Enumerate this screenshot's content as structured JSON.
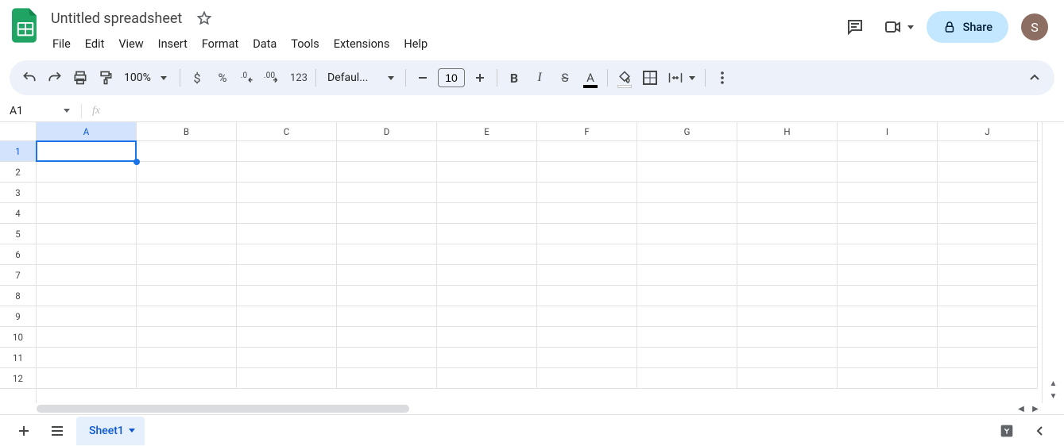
{
  "header": {
    "doc_title": "Untitled spreadsheet",
    "menus": [
      "File",
      "Edit",
      "View",
      "Insert",
      "Format",
      "Data",
      "Tools",
      "Extensions",
      "Help"
    ],
    "share_label": "Share",
    "avatar_initial": "S"
  },
  "toolbar": {
    "zoom": "100%",
    "currency_label": "$",
    "percent_label": "%",
    "num123_label": "123",
    "font_family": "Defaul...",
    "font_size": "10",
    "text_color": "#000000",
    "fill_color": "#ffffff"
  },
  "namebox": {
    "cell_ref": "A1"
  },
  "grid": {
    "columns": [
      "A",
      "B",
      "C",
      "D",
      "E",
      "F",
      "G",
      "H",
      "I",
      "J"
    ],
    "rows": [
      "1",
      "2",
      "3",
      "4",
      "5",
      "6",
      "7",
      "8",
      "9",
      "10",
      "11",
      "12"
    ],
    "selected_col": "A",
    "selected_row": "1"
  },
  "tabs": {
    "sheet_name": "Sheet1"
  }
}
